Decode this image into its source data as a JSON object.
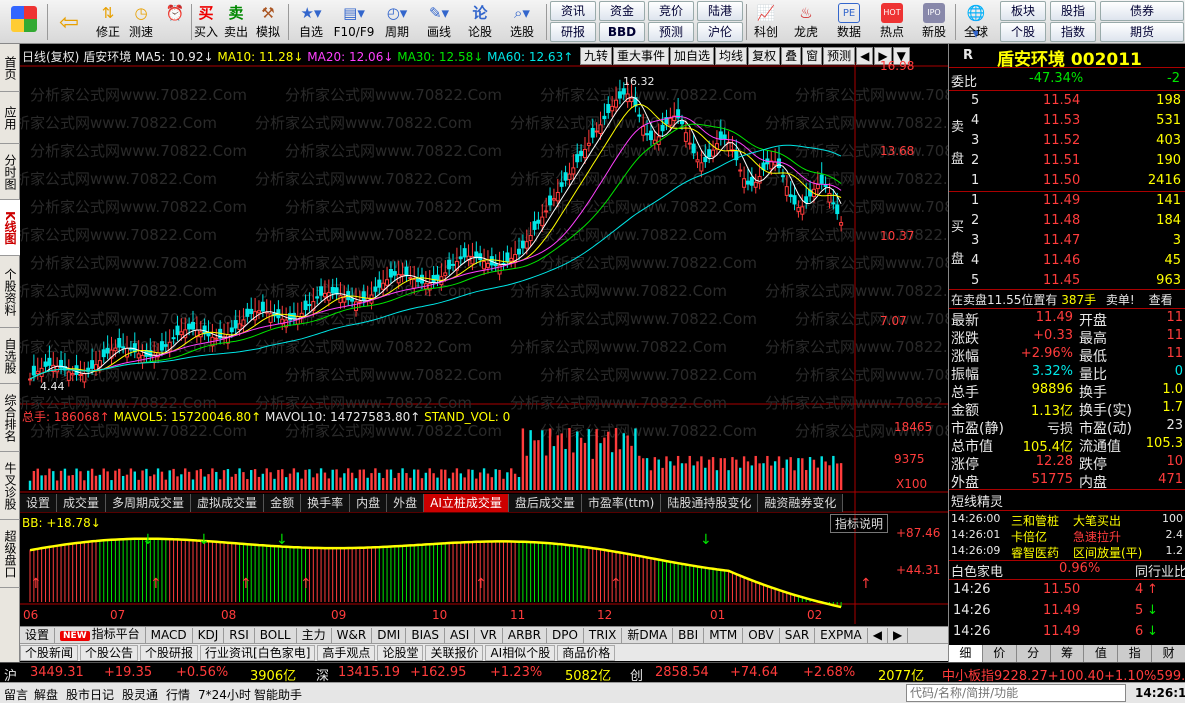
{
  "toolbar": {
    "items": [
      {
        "label": "修正",
        "icon": "arrow-left-icon"
      },
      {
        "label": "测速",
        "icon": "speed-icon"
      },
      {
        "label": "买入",
        "icon": "buy-icon"
      },
      {
        "label": "卖出",
        "icon": "sell-icon"
      },
      {
        "label": "模拟",
        "icon": "hammer-icon"
      },
      {
        "label": "自选",
        "icon": "star-icon"
      },
      {
        "label": "F10/F9",
        "icon": "f10-icon"
      },
      {
        "label": "周期",
        "icon": "cycle-icon"
      },
      {
        "label": "画线",
        "icon": "pen-icon"
      },
      {
        "label": "论股",
        "icon": "forum-icon"
      },
      {
        "label": "选股",
        "icon": "search-icon"
      }
    ],
    "buy_glyph": "买",
    "sell_glyph": "卖",
    "forum_glyph": "论",
    "small": [
      {
        "label": "资讯"
      },
      {
        "label": "资金"
      },
      {
        "label": "竞价"
      },
      {
        "label": "陆港"
      },
      {
        "label": "研报"
      },
      {
        "label": "BBD"
      },
      {
        "label": "预测"
      },
      {
        "label": "沪伦"
      }
    ],
    "more": [
      {
        "label": "科创",
        "icon": "chart-icon"
      },
      {
        "label": "龙虎",
        "icon": "dragon-icon"
      },
      {
        "label": "数据",
        "icon": "pe-icon"
      },
      {
        "label": "热点",
        "icon": "hot-icon"
      },
      {
        "label": "新股",
        "icon": "ipo-icon"
      }
    ],
    "pe_glyph": "PE",
    "hot_glyph": "HOT",
    "ipo_glyph": "IPO",
    "global_label": "全球",
    "small2": [
      {
        "label": "板块"
      },
      {
        "label": "股指"
      },
      {
        "label": "债券"
      },
      {
        "label": "个股"
      },
      {
        "label": "指数"
      },
      {
        "label": "期货"
      }
    ]
  },
  "leftnav": [
    "首页",
    "应用",
    "分时图",
    "K线图",
    "个股资料",
    "自选股",
    "综合排名",
    "牛叉诊股",
    "超级盘口"
  ],
  "chart_header": {
    "period": "日线(复权)",
    "name": "盾安环境",
    "ma5": "MA5: 10.92↓",
    "ma10": "MA10: 11.28↓",
    "ma20": "MA20: 12.06↓",
    "ma30": "MA30: 12.58↓",
    "ma60": "MA60: 12.63↑",
    "buttons": [
      "九转",
      "重大事件",
      "加自选",
      "均线",
      "复权",
      "叠",
      "窗",
      "预测"
    ],
    "arrow_left": "◀",
    "arrow_right": "▶",
    "dropdown": "▼"
  },
  "watermark": "分析家公式网www.70822.Com",
  "price_axis": [
    "16.98",
    "13.68",
    "10.37",
    "7.07"
  ],
  "high_label": "16.32",
  "low_label": "4.44",
  "vol_header": {
    "total": "总手: 186068↑",
    "mavol5": "MAVOL5: 15720046.80↑",
    "mavol10": "MAVOL10: 14727583.80↑",
    "stand": "STAND_VOL: 0"
  },
  "vol_axis": [
    "18465",
    "9375",
    "X100"
  ],
  "tabs": [
    "设置",
    "成交量",
    "多周期成交量",
    "虚拟成交量",
    "金额",
    "换手率",
    "内盘",
    "外盘",
    "AI立桩成交量",
    "盘后成交量",
    "市盈率(ttm)",
    "陆股通持股变化",
    "融资融券变化"
  ],
  "active_tab": "AI立桩成交量",
  "ind_explain": "指标说明",
  "bb_label": "BB: +18.78↓",
  "ind_axis": [
    "+87.46",
    "+44.31"
  ],
  "months": [
    "06",
    "07",
    "08",
    "09",
    "10",
    "11",
    "12",
    "01",
    "02"
  ],
  "indbar": [
    "设置",
    "指标平台",
    "MACD",
    "KDJ",
    "RSI",
    "BOLL",
    "主力",
    "W&R",
    "DMI",
    "BIAS",
    "ASI",
    "VR",
    "ARBR",
    "DPO",
    "TRIX",
    "新DMA",
    "BBI",
    "MTM",
    "OBV",
    "SAR",
    "EXPMA"
  ],
  "new_badge": "NEW",
  "newsbar": [
    "个股新闻",
    "个股公告",
    "个股研报",
    "行业资讯[白色家电]",
    "高手观点",
    "论股堂",
    "关联报价",
    "AI相似个股",
    "商品价格"
  ],
  "market": {
    "sh": {
      "label": "沪",
      "value": "3449.31",
      "chg": "+19.35",
      "pct": "+0.56%",
      "amt": "3906亿"
    },
    "sz": {
      "label": "深",
      "value": "13415.19",
      "chg": "+162.95",
      "pct": "+1.23%",
      "amt": "5082亿"
    },
    "cy": {
      "label": "创",
      "value": "2858.54",
      "chg": "+74.64",
      "pct": "+2.68%",
      "amt": "2077亿"
    },
    "zx": "中小板指9228.27+100.40+1.10%599."
  },
  "status": {
    "items": [
      "留言",
      "解盘",
      "股市日记",
      "股灵通",
      "行情",
      "7*24小时",
      "智能助手"
    ],
    "search_placeholder": "代码/名称/简拼/功能",
    "time": "14:26:1"
  },
  "quote": {
    "r": "R",
    "title": "盾安环境 002011",
    "weibi_label": "委比",
    "weibi": "-47.34%",
    "weicha": "-2",
    "sell_label": [
      "卖",
      "盘"
    ],
    "buy_label": [
      "买",
      "盘"
    ],
    "sells": [
      {
        "n": "5",
        "p": "11.54",
        "v": "198"
      },
      {
        "n": "4",
        "p": "11.53",
        "v": "531"
      },
      {
        "n": "3",
        "p": "11.52",
        "v": "403"
      },
      {
        "n": "2",
        "p": "11.51",
        "v": "190"
      },
      {
        "n": "1",
        "p": "11.50",
        "v": "2416"
      }
    ],
    "buys": [
      {
        "n": "1",
        "p": "11.49",
        "v": "141"
      },
      {
        "n": "2",
        "p": "11.48",
        "v": "184"
      },
      {
        "n": "3",
        "p": "11.47",
        "v": "3"
      },
      {
        "n": "4",
        "p": "11.46",
        "v": "45"
      },
      {
        "n": "5",
        "p": "11.45",
        "v": "963"
      }
    ],
    "alert": {
      "text": "在卖盘11.55位置有",
      "qty": "387手",
      "act": "卖单!",
      "more": "查看"
    },
    "stats": [
      {
        "l": "最新",
        "v": "11.49",
        "l2": "开盘",
        "v2": "11",
        "c": "red"
      },
      {
        "l": "涨跌",
        "v": "+0.33",
        "l2": "最高",
        "v2": "11",
        "c": "red"
      },
      {
        "l": "涨幅",
        "v": "+2.96%",
        "l2": "最低",
        "v2": "11",
        "c": "red"
      },
      {
        "l": "振幅",
        "v": "3.32%",
        "l2": "量比",
        "v2": "0",
        "c": "cyn"
      },
      {
        "l": "总手",
        "v": "98896",
        "l2": "换手",
        "v2": "1.0",
        "c": "yel"
      },
      {
        "l": "金额",
        "v": "1.13亿",
        "l2": "换手(实)",
        "v2": "1.7",
        "c": "yel"
      },
      {
        "l": "市盈(静)",
        "v": "亏损",
        "l2": "市盈(动)",
        "v2": "23",
        "c": "wht"
      },
      {
        "l": "总市值",
        "v": "105.4亿",
        "l2": "流通值",
        "v2": "105.3",
        "c": "yel"
      },
      {
        "l": "涨停",
        "v": "12.28",
        "l2": "跌停",
        "v2": "10",
        "c": "red"
      },
      {
        "l": "外盘",
        "v": "51775",
        "l2": "内盘",
        "v2": "471",
        "c": "red"
      }
    ],
    "short_title": "短线精灵",
    "short": [
      {
        "t": "14:26:00",
        "n": "三和管桩",
        "e": "大笔买出",
        "v": "100"
      },
      {
        "t": "14:26:01",
        "n": "卡倍亿",
        "e": "急速拉升",
        "v": "2.4"
      },
      {
        "t": "14:26:09",
        "n": "睿智医药",
        "e": "区间放量(平)",
        "v": "1.2"
      }
    ],
    "sector": "白色家电",
    "sector_pct": "0.96%",
    "sector_cmp": "同行业比",
    "ticks": [
      {
        "t": "14:26",
        "p": "11.50",
        "v": "4",
        "d": "↑"
      },
      {
        "t": "14:26",
        "p": "11.49",
        "v": "5",
        "d": "↓"
      },
      {
        "t": "14:26",
        "p": "11.49",
        "v": "6",
        "d": "↓"
      }
    ],
    "bottom_tabs": [
      "细",
      "价",
      "分",
      "筹",
      "值",
      "指",
      "财"
    ]
  }
}
